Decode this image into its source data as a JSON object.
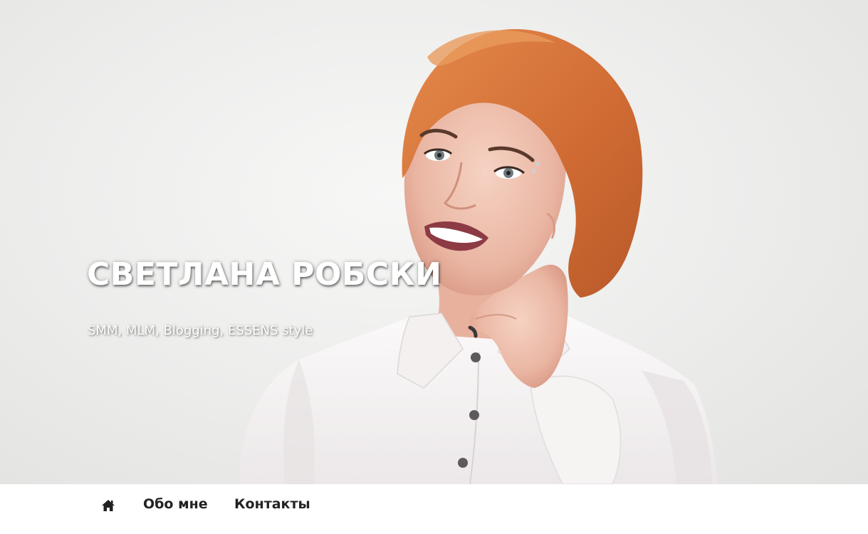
{
  "hero": {
    "title": "СВЕТЛАНА РОБСКИ",
    "subtitle": "SMM, MLM, Blogging, ESSENS style",
    "photo": "portrait-photo"
  },
  "nav": {
    "home_icon": "home-icon",
    "items": [
      {
        "label": "Обо мне"
      },
      {
        "label": "Контакты"
      }
    ]
  },
  "colors": {
    "hair": "#d9733b",
    "shirt": "#f7f4f4",
    "background": "#ececeb",
    "nav_text": "#222222"
  }
}
